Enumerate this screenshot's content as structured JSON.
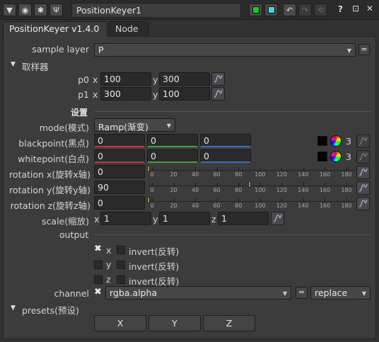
{
  "titlebar": {
    "node_name": "PositionKeyer1",
    "help": "?",
    "float": "⊡",
    "close": "✕",
    "colors": {
      "green": "#18d018",
      "cyan": "#40d8e8"
    }
  },
  "tabs": [
    {
      "label": "PositionKeyer v1.4.0"
    },
    {
      "label": "Node"
    }
  ],
  "sample_layer": {
    "label": "sample layer",
    "value": "P",
    "eq": "="
  },
  "sampler": {
    "heading": "取样器",
    "p0": {
      "label": "p0",
      "x_label": "x",
      "x": "100",
      "y_label": "y",
      "y": "300"
    },
    "p1": {
      "label": "p1",
      "x_label": "x",
      "x": "300",
      "y_label": "y",
      "y": "100"
    }
  },
  "settings": {
    "heading": "设置",
    "mode": {
      "label": "mode(模式)",
      "value": "Ramp(渐变)"
    },
    "blackpoint": {
      "label": "blackpoint(黑点)",
      "r": "0",
      "g": "0",
      "b": "0",
      "channels": "3"
    },
    "whitepoint": {
      "label": "whitepoint(白点)",
      "r": "0",
      "g": "0",
      "b": "0",
      "channels": "3"
    },
    "rotation_x": {
      "label": "rotation x(旋转x轴)",
      "value": "0",
      "fraction": 0.0
    },
    "rotation_y": {
      "label": "rotation y(旋转y轴)",
      "value": "90",
      "fraction": 0.5
    },
    "rotation_z": {
      "label": "rotation z(旋转z轴)",
      "value": "0",
      "fraction": 0.0
    },
    "ticks": [
      "0",
      "20",
      "40",
      "60",
      "80",
      "100",
      "120",
      "140",
      "160",
      "180"
    ],
    "scale": {
      "label": "scale(缩放)",
      "x_label": "x",
      "x": "1",
      "y_label": "y",
      "y": "1",
      "z_label": "z",
      "z": "1"
    }
  },
  "output": {
    "heading": "output",
    "rows": [
      {
        "axis": "x",
        "checked": true,
        "invert": "invert(反转)"
      },
      {
        "axis": "y",
        "checked": false,
        "invert": "invert(反转)"
      },
      {
        "axis": "z",
        "checked": false,
        "invert": "invert(反转)"
      }
    ]
  },
  "channel": {
    "label": "channel",
    "value": "rgba.alpha",
    "eq": "=",
    "op": "replace"
  },
  "presets": {
    "heading": "presets(预设)",
    "buttons": [
      "X",
      "Y",
      "Z"
    ]
  }
}
